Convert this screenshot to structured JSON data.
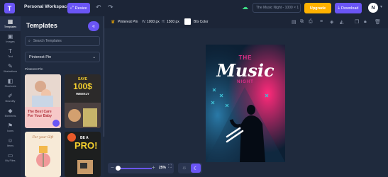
{
  "topbar": {
    "logo_glyph": "T",
    "workspace": "Personal Workspace",
    "resize_label": "Resize",
    "doc_title": "The Music Night - 1000 × 1",
    "upgrade_label": "Upgrade",
    "download_label": "Download",
    "avatar_letter": "N",
    "colors": {
      "accent": "#6a55f5",
      "upgrade": "#ffb200",
      "saved": "#3ddc84"
    }
  },
  "rail": {
    "items": [
      {
        "icon": "templates-icon",
        "label": "Templates",
        "active": true
      },
      {
        "icon": "images-icon",
        "label": "Images"
      },
      {
        "icon": "text-icon",
        "label": "Text"
      },
      {
        "icon": "illustrations-icon",
        "label": "Illustrations"
      },
      {
        "icon": "shortcuts-icon",
        "label": "Shortcuts"
      },
      {
        "icon": "brandify-icon",
        "label": "Brandify"
      },
      {
        "icon": "elements-icon",
        "label": "Elements"
      },
      {
        "icon": "icons-icon",
        "label": "Icons"
      },
      {
        "icon": "items-icon",
        "label": "Items"
      },
      {
        "icon": "my-files-icon",
        "label": "My Files"
      }
    ]
  },
  "panel": {
    "title": "Templates",
    "search_placeholder": "Search Templates",
    "dropdown_value": "Pinterest Pin",
    "section_label": "Pinterest Pin",
    "thumbs": [
      {
        "text": "The Best Care For Your Baby"
      },
      {
        "text_top": "SAVE",
        "text_big": "100$",
        "text_sub": "WEEKLY"
      },
      {
        "text": "For your Gift"
      },
      {
        "text_top": "BE A",
        "text_big": "PRO!"
      }
    ]
  },
  "toolbar": {
    "format": "Pinterest Pin",
    "w_label": "W:",
    "w_value": "1000 px",
    "h_label": "H:",
    "h_value": "1500 px",
    "bg_label": "BG Color",
    "bg_color": "#ffffff"
  },
  "poster": {
    "line1": "THE",
    "line2": "Music",
    "line3": "NIGHT"
  },
  "zoom": {
    "value": "25%",
    "level": 0.25
  }
}
